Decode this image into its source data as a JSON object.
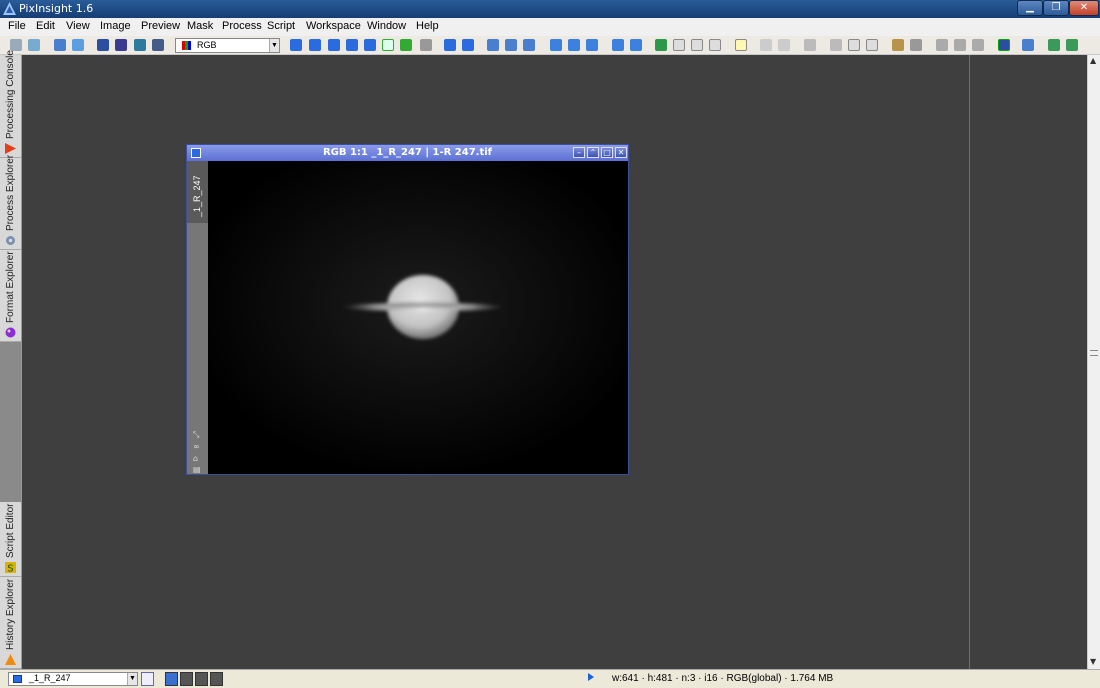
{
  "window": {
    "title": "PixInsight 1.6"
  },
  "menu": [
    "File",
    "Edit",
    "View",
    "Image",
    "Preview",
    "Mask",
    "Process",
    "Script",
    "Workspace",
    "Window",
    "Help"
  ],
  "toolbar": {
    "view_select_value": "RGB"
  },
  "left_dock": [
    "Processing Console",
    "Process Explorer",
    "Format Explorer",
    "Script Editor",
    "History Explorer"
  ],
  "image_window": {
    "title": "RGB 1:1 _1_R_247 | 1-R 247.tif",
    "side_tab_label": "_1_R_247"
  },
  "status": {
    "view_value": "_1_R_247",
    "info": "w:641 · h:481 · n:3 · i16 · RGB(global) · 1.764 MB"
  },
  "colors": {
    "title_bar": "#1f4c86",
    "workspace": "#3f3f3f",
    "image_window_title": "#6f82de"
  }
}
